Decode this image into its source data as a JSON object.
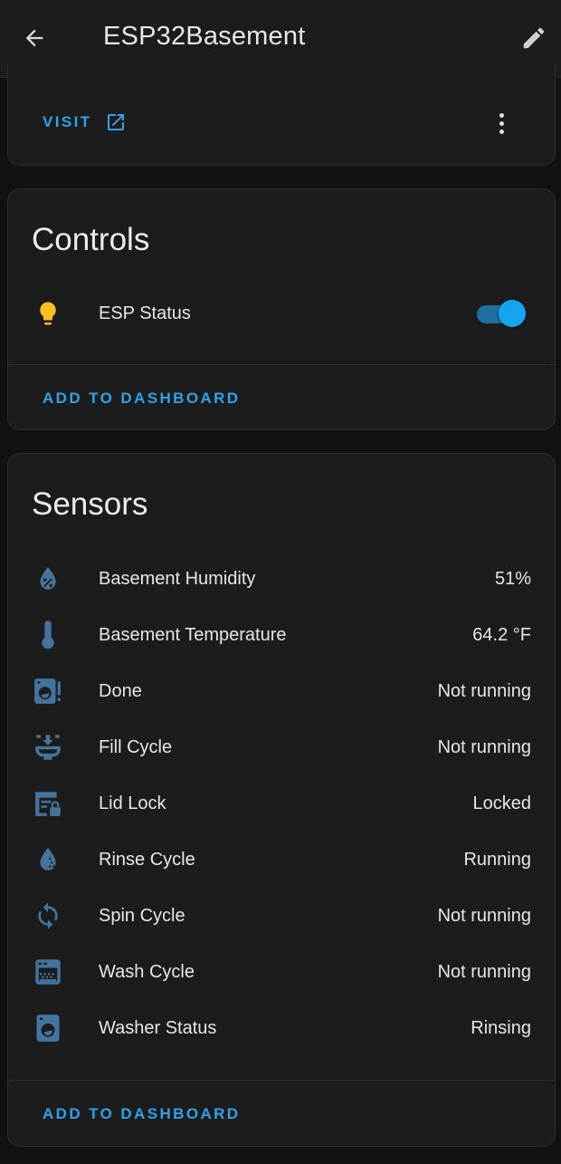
{
  "header": {
    "title": "ESP32Basement",
    "back_icon": "arrow-left-icon",
    "edit_icon": "pencil-icon"
  },
  "device_card": {
    "visit_label": "VISIT",
    "visit_icon": "open-in-new-icon",
    "more_icon": "dots-vertical-icon"
  },
  "controls": {
    "title": "Controls",
    "items": [
      {
        "label": "ESP Status",
        "icon": "lightbulb-icon",
        "state": "on"
      }
    ],
    "add_label": "ADD TO DASHBOARD"
  },
  "sensors": {
    "title": "Sensors",
    "items": [
      {
        "label": "Basement Humidity",
        "value": "51%",
        "icon": "water-percent-icon"
      },
      {
        "label": "Basement Temperature",
        "value": "64.2 °F",
        "icon": "thermometer-icon"
      },
      {
        "label": "Done",
        "value": "Not running",
        "icon": "washing-machine-alert-icon"
      },
      {
        "label": "Fill Cycle",
        "value": "Not running",
        "icon": "water-fill-icon"
      },
      {
        "label": "Lid Lock",
        "value": "Locked",
        "icon": "lid-lock-icon"
      },
      {
        "label": "Rinse Cycle",
        "value": "Running",
        "icon": "water-opacity-icon"
      },
      {
        "label": "Spin Cycle",
        "value": "Not running",
        "icon": "sync-icon"
      },
      {
        "label": "Wash Cycle",
        "value": "Not running",
        "icon": "wash-cycle-icon"
      },
      {
        "label": "Washer Status",
        "value": "Rinsing",
        "icon": "washing-machine-icon"
      }
    ],
    "add_label": "ADD TO DASHBOARD"
  },
  "colors": {
    "accent": "#2ea3ea",
    "icon": "#44739e",
    "bulb": "#fdc020",
    "toggle_thumb": "#14a4f0",
    "card_bg": "#1c1c1c",
    "page_bg": "#111111"
  }
}
